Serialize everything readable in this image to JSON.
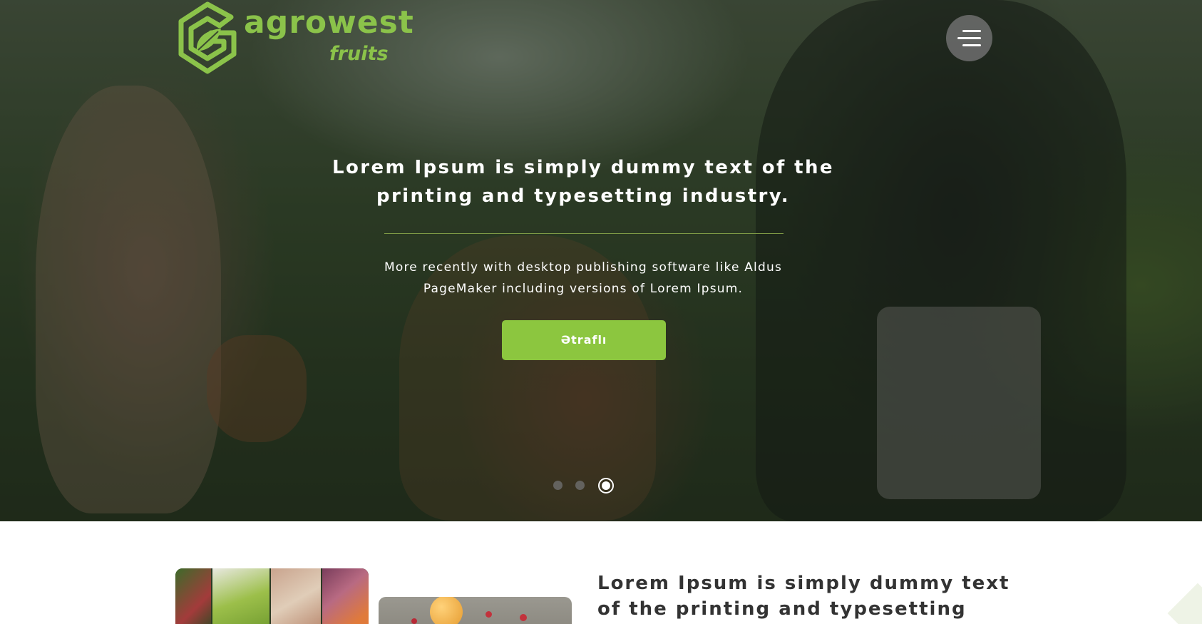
{
  "colors": {
    "accent": "#8cc63f",
    "logo_green": "#8bc34a",
    "title_dark": "#333333",
    "divider": "#7e9a45"
  },
  "header": {
    "logo": {
      "name": "agrowest",
      "sub": "fruits",
      "mark_icon": "leaf-g-logo-icon"
    },
    "menu_icon": "hamburger-menu-icon"
  },
  "hero": {
    "title": "Lorem Ipsum is simply dummy text of the printing and typesetting industry.",
    "text": "More recently with desktop publishing software like Aldus PageMaker including versions of Lorem Ipsum.",
    "button_label": "Ətraflı",
    "slides_total": 3,
    "active_slide": 3
  },
  "section": {
    "title": "Lorem Ipsum is simply dummy text of the printing and typesetting"
  }
}
